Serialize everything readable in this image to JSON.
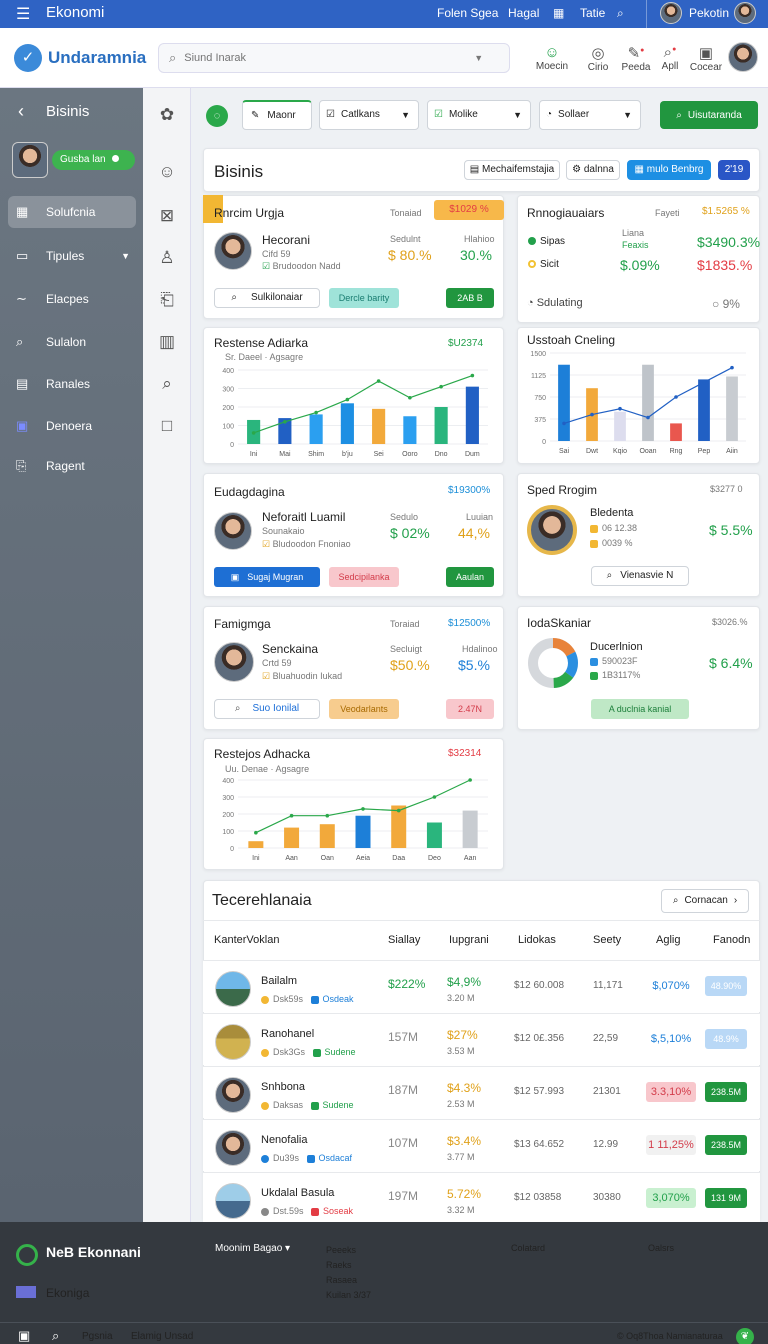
{
  "topbar": {
    "title": "Ekonomi",
    "link1": "Folen Sgea",
    "link2": "Hagal",
    "link3": "Tatie",
    "user": "Pekotin"
  },
  "header": {
    "logo": "Undaramnia",
    "search_placeholder": "Siund Inarak",
    "icons": [
      {
        "label": "Moecin",
        "icon": "person-icon"
      },
      {
        "label": "Cirio",
        "icon": "globe-icon"
      },
      {
        "label": "Peeda",
        "icon": "pen-icon"
      },
      {
        "label": "Apll",
        "icon": "search-icon"
      },
      {
        "label": "Cocear",
        "icon": "doc-icon"
      }
    ]
  },
  "sidebar": {
    "heading": "Bisinis",
    "badge": "Gusba lan",
    "items": [
      {
        "label": "Solufcnia",
        "icon": "grid-icon"
      },
      {
        "label": "Tipules",
        "icon": "folder-icon"
      },
      {
        "label": "Elacpes",
        "icon": "wave-icon"
      },
      {
        "label": "Sulalon",
        "icon": "search-icon"
      },
      {
        "label": "Ranales",
        "icon": "chart-icon"
      },
      {
        "label": "Denoera",
        "icon": "calendar-icon"
      },
      {
        "label": "Ragent",
        "icon": "doc-icon"
      }
    ]
  },
  "toolbar": {
    "tab": "Maonr",
    "dd1": "Catlkans",
    "dd2": "Molike",
    "dd3": "Sollaer",
    "primary": "Uisutaranda"
  },
  "panel": {
    "title": "Bisinis",
    "search_btn": "Mechaifemstajia",
    "btn2": "dalnna",
    "btn3": "mulo Benbrg",
    "btn4": "2'19"
  },
  "card1": {
    "title": "Rnrcim Urgja",
    "sub": "Tonaiad",
    "badge": "$1029 %",
    "name": "Hecorani",
    "line1": "Cifd 59",
    "line2": "Brudoodon Nadd",
    "lbl_a": "Sedulnt",
    "lbl_b": "Hlahioo",
    "val_a": "$ 80.%",
    "val_b": "30.%",
    "btn_a": "Sulkilonaiar",
    "btn_b": "Dercle barity",
    "btn_c": "2AB B"
  },
  "card2": {
    "title": "Rnnogiauaiars",
    "sub": "Fayeti",
    "badge": "$1.5265 %",
    "rows": [
      {
        "label": "Sipas",
        "sub": "Liana",
        "val": "$3490.3%"
      },
      {
        "label": "Sicit",
        "sub": "Feaxis",
        "val_left": "$.09%",
        "val": "$1835.%"
      }
    ],
    "status": "Sdulating",
    "pct": "9%"
  },
  "chart1": {
    "title": "Restense Adiarka",
    "badge": "$U2374",
    "legend": "Sr. Daeel",
    "legend2": "Agsagre"
  },
  "chart2": {
    "title": "Usstoah Cneling"
  },
  "card3": {
    "title": "Eudagdagina",
    "badge": "$19300%",
    "name": "Neforaitl Luamil",
    "line1": "Sounakaio",
    "line2": "Bludoodon Fnoniao",
    "lbl_a": "Sedulo",
    "lbl_b": "Luuian",
    "val_a": "$ 02%",
    "val_b": "44,%",
    "btn_a": "Sugaj Mugran",
    "btn_b": "Sedcipilanka",
    "btn_c": "Aaulan"
  },
  "card4": {
    "title": "Sped Rrogim",
    "badge": "$3277 0",
    "name": "Bledenta",
    "line1": "06 12.38",
    "line2": "0039 %",
    "val": "$ 5.5%",
    "btn": "Vienasvie N"
  },
  "card5": {
    "title": "Famigmga",
    "sub": "Toraiad",
    "badge": "$12500%",
    "name": "Senckaina",
    "line1": "Crtd 59",
    "line2": "Bluahuodin Iukad",
    "lbl_a": "Secluigt",
    "lbl_b": "Hdalinoo",
    "val_a": "$50.%",
    "val_b": "$5.%",
    "btn_a": "Suo Ionilal",
    "btn_b": "Veodarlants",
    "btn_c": "2.47N"
  },
  "card6": {
    "title": "IodaSkaniar",
    "badge": "$3026.%",
    "name": "Ducerlnion",
    "line1": "590023F",
    "line2": "1B3117%",
    "val": "$ 6.4%",
    "btn": "A duclnia kanial"
  },
  "chart3": {
    "title": "Restejos Adhacka",
    "badge": "$32314",
    "legend": "Uu. Denae",
    "legend2": "Agsagre"
  },
  "table": {
    "title": "Tecerehlanaia",
    "search_btn": "Cornacan",
    "headers": [
      "KanterVoklan",
      "Siallay",
      "Iupgrani",
      "Lidokas",
      "Seety",
      "Aglig",
      "Fanodn"
    ],
    "rows": [
      {
        "name": "Bailalm",
        "tag1": "Dsk59s",
        "tag2": "Osdeak",
        "c1": "$222%",
        "c2": "$4,9%",
        "c2b": "3.20 M",
        "c3": "$12 60.008",
        "c4": "11,171",
        "c5": "$,070%",
        "c6": "48.90%"
      },
      {
        "name": "Ranohanel",
        "tag1": "Dsk3Gs",
        "tag2": "Sudene",
        "c1": "157M",
        "c2": "$27%",
        "c2b": "3.53 M",
        "c3": "$12 0£.356",
        "c4": "22,59",
        "c5": "$,5,10%",
        "c6": "48.9%"
      },
      {
        "name": "Snhbona",
        "tag1": "Daksas",
        "tag2": "Sudene",
        "c1": "187M",
        "c2": "$4.3%",
        "c2b": "2.53 M",
        "c3": "$12 57.993",
        "c4": "21301",
        "c5": "3.3,10%",
        "c6": "238.5M"
      },
      {
        "name": "Nenofalia",
        "tag1": "Du39s",
        "tag2": "Osdacaf",
        "c1": "107M",
        "c2": "$3.4%",
        "c2b": "3.77 M",
        "c3": "$13 64.652",
        "c4": "12.99",
        "c5": "1 11,25%",
        "c6": "238.5M"
      },
      {
        "name": "Ukdalal Basula",
        "tag1": "Dst.59s",
        "tag2": "Soseak",
        "c1": "197M",
        "c2": "5.72%",
        "c2b": "3.32 M",
        "c3": "$12 03858",
        "c4": "30380",
        "c5": "3,070%",
        "c6": "131 9M"
      }
    ]
  },
  "footer": {
    "brand": "NeB Ekonnani",
    "sub": "Ekoniga",
    "menu": "Moonim Bagao",
    "links": [
      "Peeeks",
      "Raeks",
      "Rasaea",
      "Kuilan 3/37"
    ],
    "col2": "Colatard",
    "col3": "Oalsrs",
    "copyright": "Oq8Thoa Namianaturaa",
    "bottom1": "Pgsnia",
    "bottom2": "Elamig Unsad"
  },
  "colors": {
    "accent": "#2f63c4",
    "green": "#22a04b",
    "red": "#e33c44",
    "orange": "#f2a93b"
  },
  "chart_data": [
    {
      "type": "bar",
      "title": "Restense Adiarka",
      "categories": [
        "Ini",
        "Mai",
        "Shim",
        "b'ju",
        "Sei",
        "Ooro",
        "Dno",
        "Dum"
      ],
      "values": [
        130,
        140,
        160,
        220,
        190,
        150,
        200,
        310
      ],
      "line": [
        60,
        120,
        170,
        240,
        340,
        250,
        310,
        370
      ],
      "ylim": [
        0,
        400
      ]
    },
    {
      "type": "bar",
      "title": "Usstoah Cneling",
      "categories": [
        "Sai",
        "Dwt",
        "Kqio",
        "Ooan",
        "Rng",
        "Pep",
        "Aiin"
      ],
      "values": [
        1300,
        900,
        500,
        1300,
        300,
        1050,
        1100
      ],
      "line": [
        300,
        450,
        550,
        400,
        750,
        1000,
        1250
      ],
      "ylim": [
        0,
        1500
      ]
    },
    {
      "type": "bar",
      "title": "Restejos Adhacka",
      "categories": [
        "Ini",
        "Aan",
        "Oan",
        "Aeia",
        "Daa",
        "Deo",
        "Aan"
      ],
      "values": [
        40,
        120,
        140,
        190,
        250,
        150,
        220
      ],
      "line": [
        90,
        190,
        190,
        230,
        220,
        300,
        400
      ],
      "ylim": [
        0,
        400
      ]
    }
  ]
}
